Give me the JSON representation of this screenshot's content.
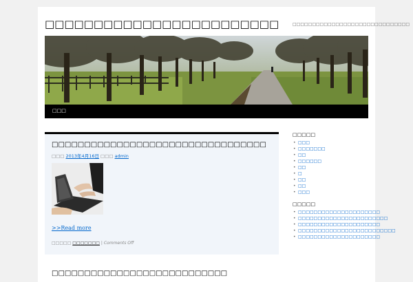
{
  "site": {
    "title": "□□□□□□□□□□□□□□□□□□□□□□□□",
    "tagline": "□□□□□□□□□□□□□□□□□□□□□□□□□□□□□□"
  },
  "nav": {
    "home": "□□□"
  },
  "post": {
    "title": "□□□□□□□□□□□□□□□□□□□□□□□□□□□□□□□□□",
    "meta_prefix": "□□□",
    "date": "2013年4月16日",
    "author_prefix": "□□□",
    "author": "admin",
    "read_more": ">>Read more",
    "category_prefix": "□□□□□",
    "category": "□□□□□□□",
    "separator": "|",
    "comments": "Comments Off"
  },
  "post2": {
    "title": "□□□□□□□□□□□□□□□□□□□□□□□□□□□"
  },
  "sidebar": {
    "categories_title": "□□□□□",
    "categories": [
      "□□□",
      "□□□□□□□",
      "□□",
      "□□□□□□",
      "□□",
      "□",
      "□□",
      "□□",
      "□□□"
    ],
    "recent_title": "□□□□□",
    "recent_posts": [
      "□□□□□□□□□□□□□□□□□□□□□",
      "□□□□□□□□□□□□□□□□□□□□□□□",
      "□□□□□□□□□□□□□□□□□□□□□",
      "□□□□□□□□□□□□□□□□□□□□□□□□□",
      "□□□□□□□□□□□□□□□□□□□□□"
    ]
  },
  "colors": {
    "link": "#0066cc",
    "nav_bg": "#000000",
    "post_bg": "#f1f5fa"
  }
}
